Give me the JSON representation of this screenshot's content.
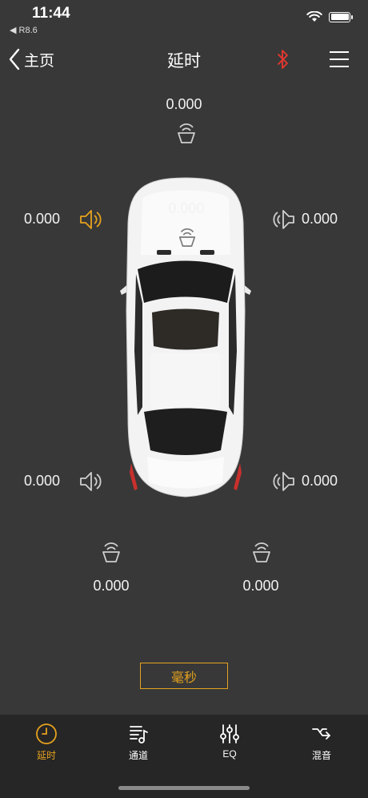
{
  "status_bar": {
    "time": "11:44",
    "back_app": "◀ R8.6"
  },
  "nav": {
    "back_label": "主页",
    "title": "延时"
  },
  "channels": {
    "center_front": "0.000",
    "center_car": "0.000",
    "front_left": "0.000",
    "front_right": "0.000",
    "rear_left": "0.000",
    "rear_right": "0.000",
    "sub_left": "0.000",
    "sub_right": "0.000"
  },
  "unit_button": "毫秒",
  "tabs": [
    {
      "label": "延时",
      "icon": "clock-icon",
      "active": true
    },
    {
      "label": "通道",
      "icon": "music-list-icon",
      "active": false
    },
    {
      "label": "EQ",
      "icon": "sliders-icon",
      "active": false
    },
    {
      "label": "混音",
      "icon": "shuffle-icon",
      "active": false
    }
  ],
  "colors": {
    "accent": "#e6a21d",
    "bluetooth": "#e8372f",
    "background": "#383838",
    "tabbar": "#262626"
  }
}
